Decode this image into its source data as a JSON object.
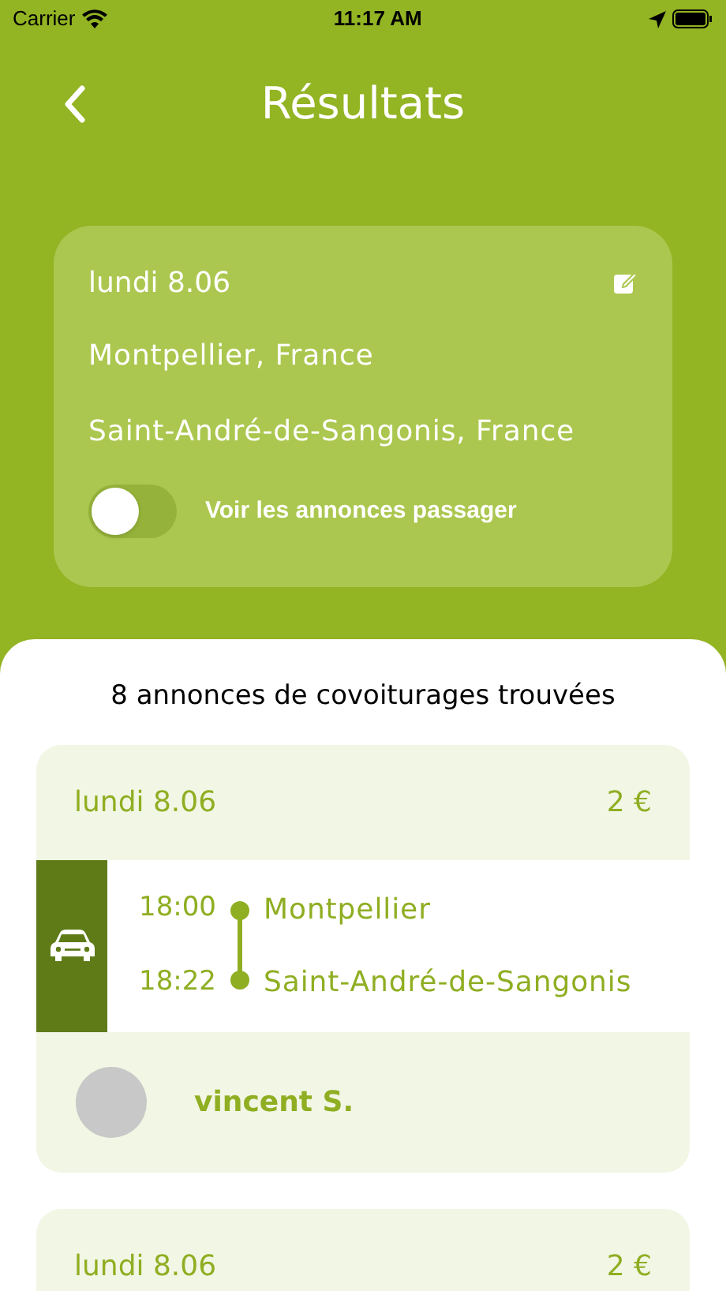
{
  "status_bar": {
    "carrier": "Carrier",
    "time": "11:17 AM"
  },
  "header": {
    "title": "Résultats"
  },
  "search": {
    "date": "lundi 8.06",
    "from": "Montpellier, France",
    "to": "Saint-André-de-Sangonis, France",
    "toggle": {
      "label": "Voir les annonces passager",
      "on": false
    }
  },
  "results_count": "8 annonces de covoiturages trouvées",
  "rides": [
    {
      "date": "lundi 8.06",
      "price": "2 €",
      "departure_time": "18:00",
      "departure": "Montpellier",
      "arrival_time": "18:22",
      "arrival": "Saint-André-de-Sangonis",
      "driver": "vincent S."
    },
    {
      "date": "lundi 8.06",
      "price": "2 €"
    }
  ]
}
